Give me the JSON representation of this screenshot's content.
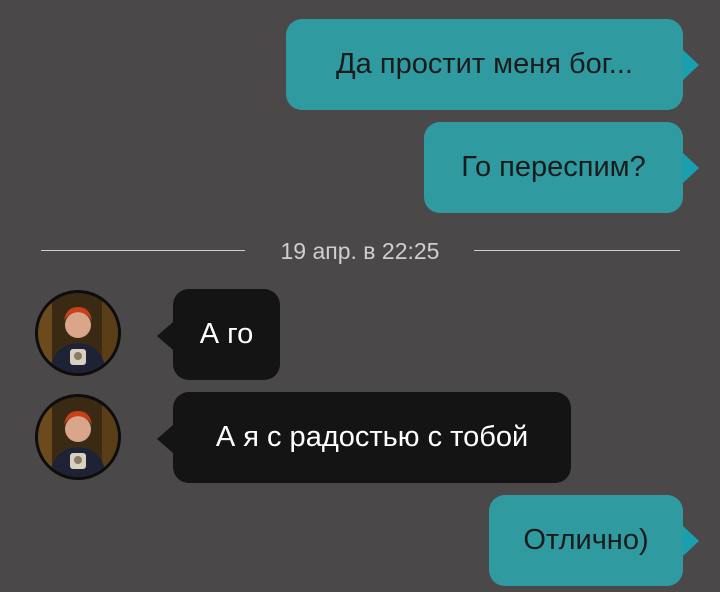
{
  "messages": [
    {
      "direction": "outgoing",
      "text": "Да простит меня бог..."
    },
    {
      "direction": "outgoing",
      "text": "Го переспим?"
    },
    {
      "direction": "incoming",
      "text": "А го"
    },
    {
      "direction": "incoming",
      "text": "А я с радостью с тобой"
    },
    {
      "direction": "outgoing",
      "text": "Отлично)"
    }
  ],
  "divider": {
    "date_text": "19 апр. в 22:25"
  },
  "colors": {
    "background": "#4a4849",
    "outgoing_bubble": "#2f9ba1",
    "incoming_bubble": "#141414",
    "outgoing_tail": "#1a9fb0"
  }
}
